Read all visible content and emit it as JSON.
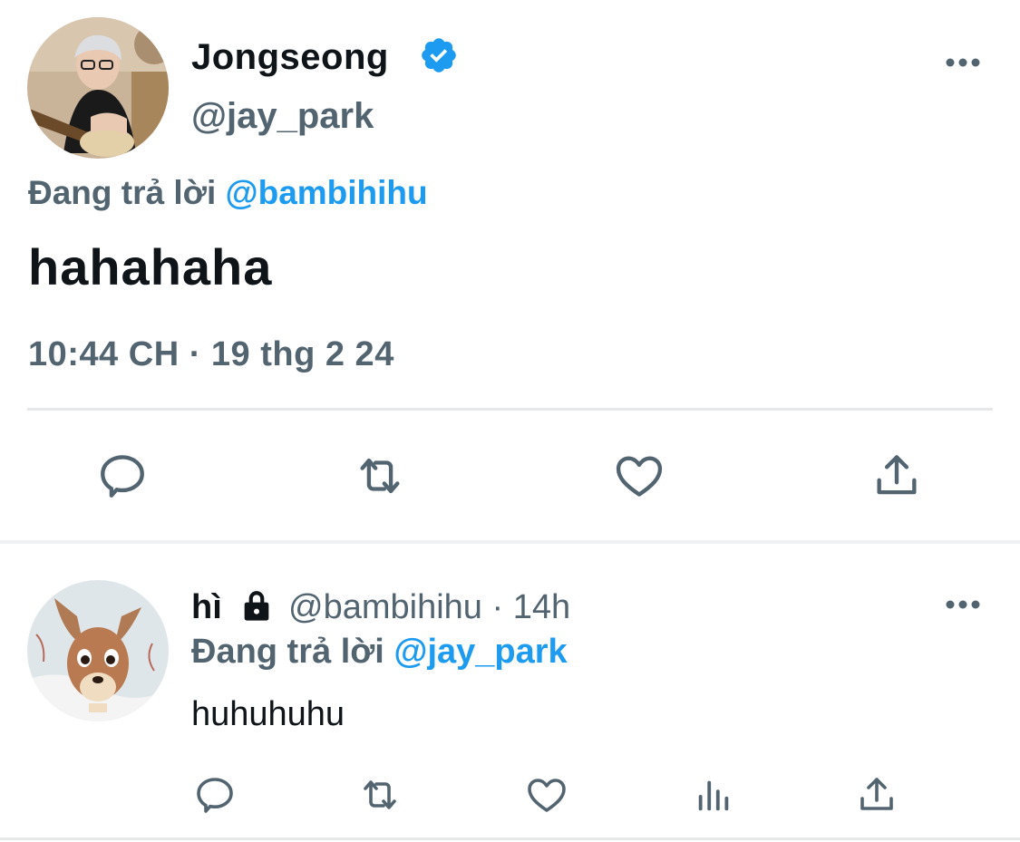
{
  "main_tweet": {
    "display_name": "Jongseong",
    "handle": "@jay_park",
    "replying_prefix": "Đang trả lời",
    "replying_to": "@bambihihu",
    "text": "hahahaha",
    "timestamp": "10:44 CH · 19 thg 2 24",
    "verified": true,
    "avatar": "guitar-player-photo",
    "actions": [
      "reply-icon",
      "retweet-icon",
      "like-icon",
      "share-icon"
    ]
  },
  "reply_tweet": {
    "display_name": "hì",
    "protected": true,
    "handle": "@bambihihu",
    "separator": "·",
    "time_ago": "14h",
    "replying_prefix": "Đang trả lời",
    "replying_to": "@jay_park",
    "text": "huhuhuhu",
    "avatar": "bambi-cartoon",
    "actions": [
      "reply-icon",
      "retweet-icon",
      "like-icon",
      "views-icon",
      "share-icon"
    ]
  },
  "colors": {
    "accent": "#1d9bf0",
    "secondary_text": "#536471",
    "primary_text": "#0f1419",
    "icon": "#536471"
  }
}
